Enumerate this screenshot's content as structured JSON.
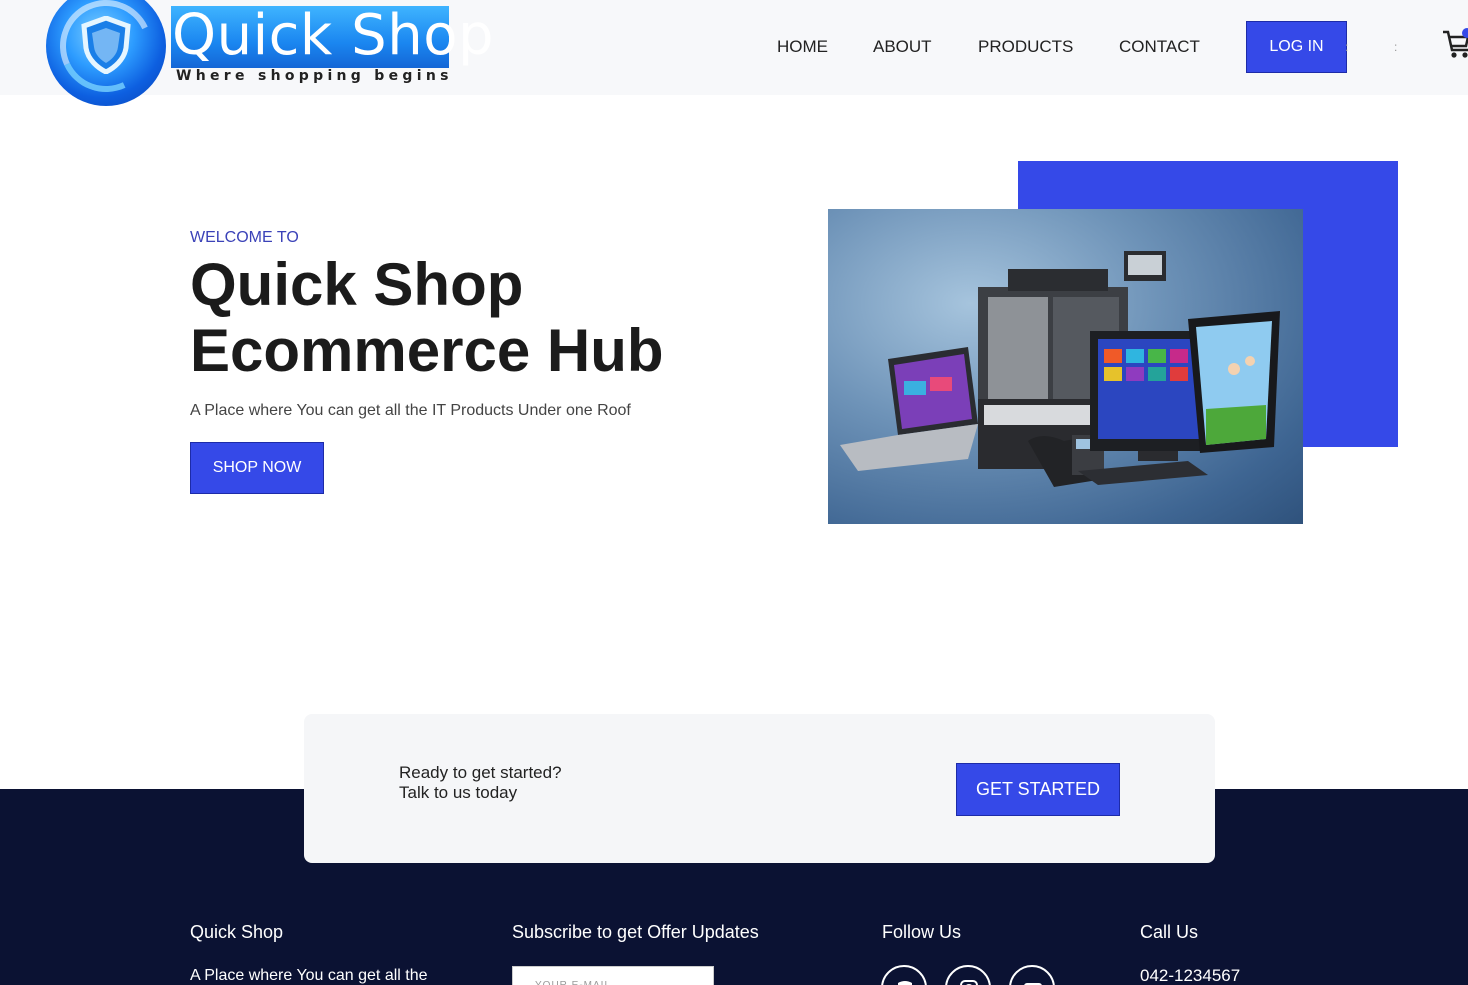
{
  "colors": {
    "accent": "#3549e8",
    "footer": "#0b1233",
    "header": "#f7f8fa",
    "welcome": "#3b42b8"
  },
  "logo": {
    "title": "Quick Shop",
    "tagline": "Where shopping begins"
  },
  "nav": {
    "home": "HOME",
    "about": "ABOUT",
    "products": "PRODUCTS",
    "contact": "CONTACT",
    "login": "LOG IN"
  },
  "hero": {
    "welcome": "WELCOME TO",
    "title_line1": "Quick Shop",
    "title_line2": "Ecommerce Hub",
    "subtitle": "A Place where You can get all the IT Products Under one Roof",
    "cta": "SHOP NOW",
    "image_icon": "it-products-photo"
  },
  "cta": {
    "line1": "Ready to get started?",
    "line2": "Talk to us today",
    "button": "GET STARTED"
  },
  "footer": {
    "about_title": "Quick Shop",
    "about_text": "A Place where You can get all the",
    "subscribe_title": "Subscribe to get Offer Updates",
    "email_placeholder": "YOUR E-MAIL",
    "follow_title": "Follow Us",
    "social_icons": [
      "facebook-icon",
      "instagram-icon",
      "youtube-icon"
    ],
    "call_title": "Call Us",
    "phone": "042-1234567"
  }
}
